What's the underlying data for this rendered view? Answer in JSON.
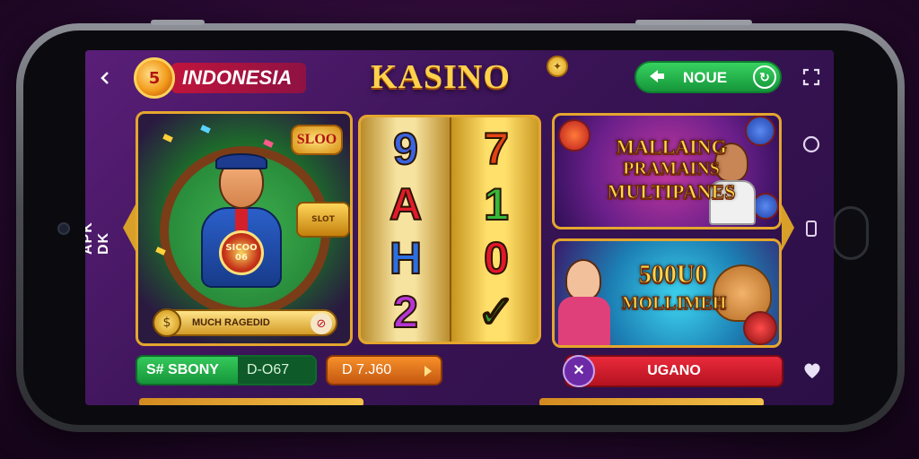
{
  "header": {
    "back_icon": "chevron-left-icon",
    "brand_badge_glyph": "5",
    "region_label": "INDONESIA",
    "logo_text": "KASINO",
    "logo_coin_glyph": "✦",
    "move_button_label": "NOUE",
    "move_button_left_icon": "arrow-right-icon",
    "move_button_right_icon": "refresh-icon",
    "settings_icon": "expand-icon"
  },
  "side": {
    "left_label": "APK DK",
    "right_icons": [
      "circle-icon",
      "phone-rotate-icon"
    ]
  },
  "featured_game": {
    "slot_badge": "SLOO",
    "chip_text": "SICOO 06",
    "treasure_text": "SLOT",
    "footer_label": "MUCH RAGEDID",
    "footer_coin_glyph": "$",
    "footer_icon": "no-icon"
  },
  "reels": {
    "column1": [
      "9",
      "A",
      "H",
      "2"
    ],
    "column2": [
      "7",
      "1",
      "0",
      "✓"
    ],
    "colors1": [
      "#3a64e0",
      "#e11d2b",
      "#2d6fe0",
      "#b536d6"
    ],
    "colors2": [
      "#e34416",
      "#36b93b",
      "#e3172a",
      "#2ea038"
    ]
  },
  "promo1": {
    "line1": "MALLAING",
    "line2": "PRAMAINS",
    "line3": "MULTIPANES"
  },
  "promo2": {
    "line1": "500U0",
    "line2": "MOLLIMEH"
  },
  "bottom_bar": {
    "green_label": "S# SBONY",
    "green_value": "D-O67",
    "orange_label": "D 7.J60",
    "red_label": "UGANO",
    "red_icon": "sword-icon",
    "heart_icon": "heart-icon"
  },
  "colors": {
    "accent_gold": "#e4a62e",
    "screen_purple": "#3a1456",
    "green": "#1fa844",
    "red": "#d71c2c",
    "orange": "#e3741c"
  }
}
